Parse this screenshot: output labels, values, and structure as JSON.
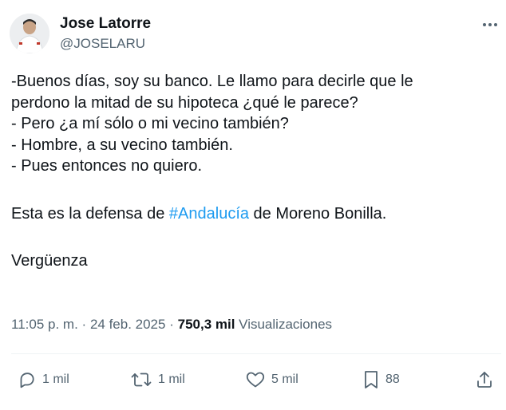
{
  "author": {
    "name": "Jose Latorre",
    "handle": "@JOSELARU"
  },
  "tweet": {
    "lines": [
      "-Buenos días, soy su banco. Le llamo para decirle que le",
      "perdono la mitad de su hipoteca ¿qué le parece?",
      "- Pero ¿a mí sólo o mi vecino también?",
      "- Hombre, a su vecino también.",
      "- Pues entonces no quiero."
    ],
    "defense": {
      "before": "Esta es la defensa de ",
      "hashtag": "#Andalucía",
      "after": " de Moreno Bonilla."
    },
    "closing": "Vergüenza"
  },
  "meta": {
    "time": "11:05 p. m.",
    "separator": "·",
    "date": "24 feb. 2025",
    "views_count": "750,3 mil",
    "views_label": "Visualizaciones"
  },
  "actions": {
    "replies": "1 mil",
    "reposts": "1 mil",
    "likes": "5 mil",
    "bookmarks": "88"
  },
  "colors": {
    "link": "#1d9bf0",
    "text": "#0f1419",
    "muted": "#536471"
  },
  "icons": [
    "more-icon",
    "reply-icon",
    "repost-icon",
    "like-icon",
    "bookmark-icon",
    "share-icon"
  ]
}
